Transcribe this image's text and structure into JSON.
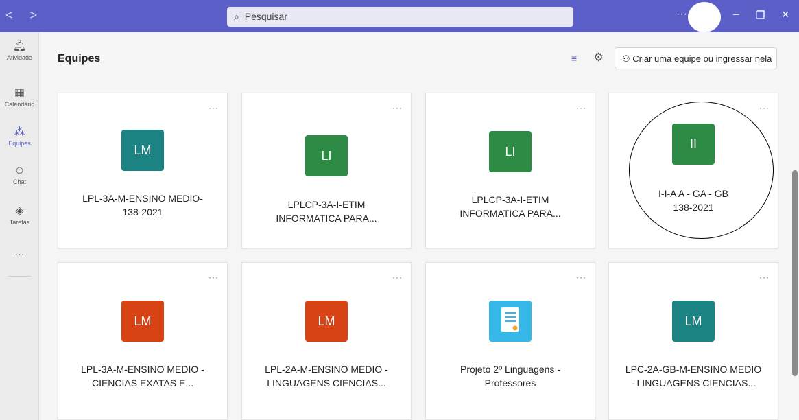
{
  "titlebar": {
    "nav": "<  >",
    "search_icon": "magnifier-icon",
    "search_placeholder": "Pesquisar",
    "more": "···",
    "minimize": "−",
    "maximize": "❐",
    "close": "×"
  },
  "rail": {
    "items": [
      {
        "label": "Atividade",
        "icon": "bell-icon",
        "glyph": "🔔︎"
      },
      {
        "label": "Calendário",
        "icon": "calendar-icon",
        "glyph": "▦"
      },
      {
        "label": "Equipes",
        "icon": "teams-icon",
        "glyph": "⁂"
      },
      {
        "label": "Chat",
        "icon": "chat-icon",
        "glyph": "☺"
      },
      {
        "label": "Tarefas",
        "icon": "assignments-icon",
        "glyph": "◈"
      }
    ],
    "more": "···"
  },
  "header": {
    "title": "Equipes",
    "filter_glyph": "≡",
    "gear_glyph": "⚙",
    "create_label": "Criar uma equipe ou ingressar nela",
    "create_glyph": "⚇"
  },
  "teams": [
    {
      "initials": "LM",
      "color": "#1c8383",
      "name_line1": "LPL-3A-M-ENSINO MEDIO-",
      "name_line2": "138-2021"
    },
    {
      "initials": "LI",
      "color": "#2e8b45",
      "name_line1": "LPLCP-3A-I-ETIM",
      "name_line2": "INFORMATICA PARA..."
    },
    {
      "initials": "LI",
      "color": "#2e8b45",
      "name_line1": "LPLCP-3A-I-ETIM",
      "name_line2": "INFORMATICA PARA..."
    },
    {
      "initials": "II",
      "color": "#2e8b45",
      "name_line1": "I-I-A A - GA - GB",
      "name_line2": "138-2021"
    },
    {
      "initials": "LM",
      "color": "#d84315",
      "name_line1": "LPL-3A-M-ENSINO MEDIO -",
      "name_line2": "CIENCIAS EXATAS E..."
    },
    {
      "initials": "LM",
      "color": "#d84315",
      "name_line1": "LPL-2A-M-ENSINO MEDIO -",
      "name_line2": "LINGUAGENS CIENCIAS..."
    },
    {
      "initials": "",
      "color": "#35b8e8",
      "name_line1": "Projeto 2º Linguagens -",
      "name_line2": "Professores"
    },
    {
      "initials": "LM",
      "color": "#1c8383",
      "name_line1": "LPC-2A-GB-M-ENSINO MEDIO",
      "name_line2": "- LINGUAGENS CIENCIAS..."
    }
  ],
  "card_more": "···"
}
